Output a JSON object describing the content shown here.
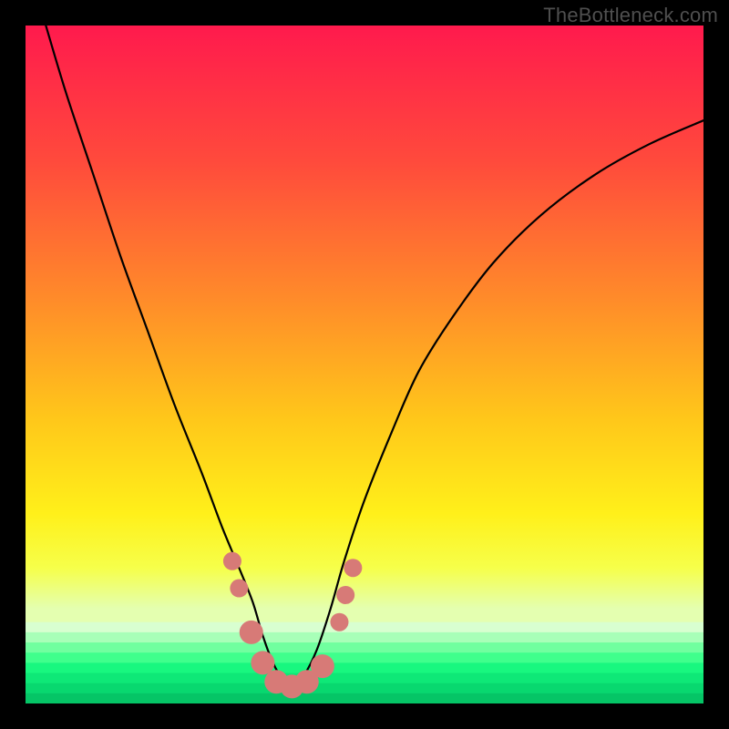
{
  "watermark": "TheBottleneck.com",
  "chart_data": {
    "type": "line",
    "title": "",
    "xlabel": "",
    "ylabel": "",
    "xlim": [
      0,
      100
    ],
    "ylim": [
      0,
      100
    ],
    "background_gradient": {
      "upper_stops": [
        {
          "offset": 0.0,
          "color": "#ff1a4d"
        },
        {
          "offset": 0.2,
          "color": "#ff4a3c"
        },
        {
          "offset": 0.4,
          "color": "#ff8a2a"
        },
        {
          "offset": 0.58,
          "color": "#ffc71a"
        },
        {
          "offset": 0.72,
          "color": "#fff01a"
        },
        {
          "offset": 0.8,
          "color": "#f6ff4a"
        },
        {
          "offset": 0.86,
          "color": "#e4ffb0"
        }
      ],
      "lower_band": {
        "start_y": 88,
        "colors_top_to_bottom": [
          "#d8ffd0",
          "#a8ffb8",
          "#70ff9f",
          "#3fff8c",
          "#18f77f",
          "#0ee877",
          "#08d86f",
          "#05c566"
        ]
      }
    },
    "series": [
      {
        "name": "main-curve",
        "color": "#000000",
        "stroke_width": 2.2,
        "x": [
          3,
          6,
          10,
          14,
          18,
          22,
          26,
          29,
          31.5,
          33.5,
          35,
          36.5,
          38,
          39.5,
          41,
          43,
          45,
          47,
          50,
          54,
          58,
          63,
          69,
          76,
          84,
          92,
          100
        ],
        "y": [
          100,
          90,
          78,
          66,
          55,
          44,
          34,
          26,
          20,
          15,
          10,
          6,
          3.5,
          2.5,
          4,
          8,
          14,
          21,
          30,
          40,
          49,
          57,
          65,
          72,
          78,
          82.5,
          86
        ]
      }
    ],
    "markers": {
      "name": "bottom-markers",
      "color": "#d77a77",
      "radius_small": 10,
      "radius_large": 13,
      "points": [
        {
          "x": 30.5,
          "y": 21,
          "r": 10
        },
        {
          "x": 31.5,
          "y": 17,
          "r": 10
        },
        {
          "x": 33.3,
          "y": 10.5,
          "r": 13
        },
        {
          "x": 35.0,
          "y": 6.0,
          "r": 13
        },
        {
          "x": 37.0,
          "y": 3.2,
          "r": 13
        },
        {
          "x": 39.3,
          "y": 2.5,
          "r": 13
        },
        {
          "x": 41.5,
          "y": 3.2,
          "r": 13
        },
        {
          "x": 43.8,
          "y": 5.5,
          "r": 13
        },
        {
          "x": 46.3,
          "y": 12.0,
          "r": 10
        },
        {
          "x": 47.2,
          "y": 16.0,
          "r": 10
        },
        {
          "x": 48.3,
          "y": 20.0,
          "r": 10
        }
      ]
    }
  }
}
